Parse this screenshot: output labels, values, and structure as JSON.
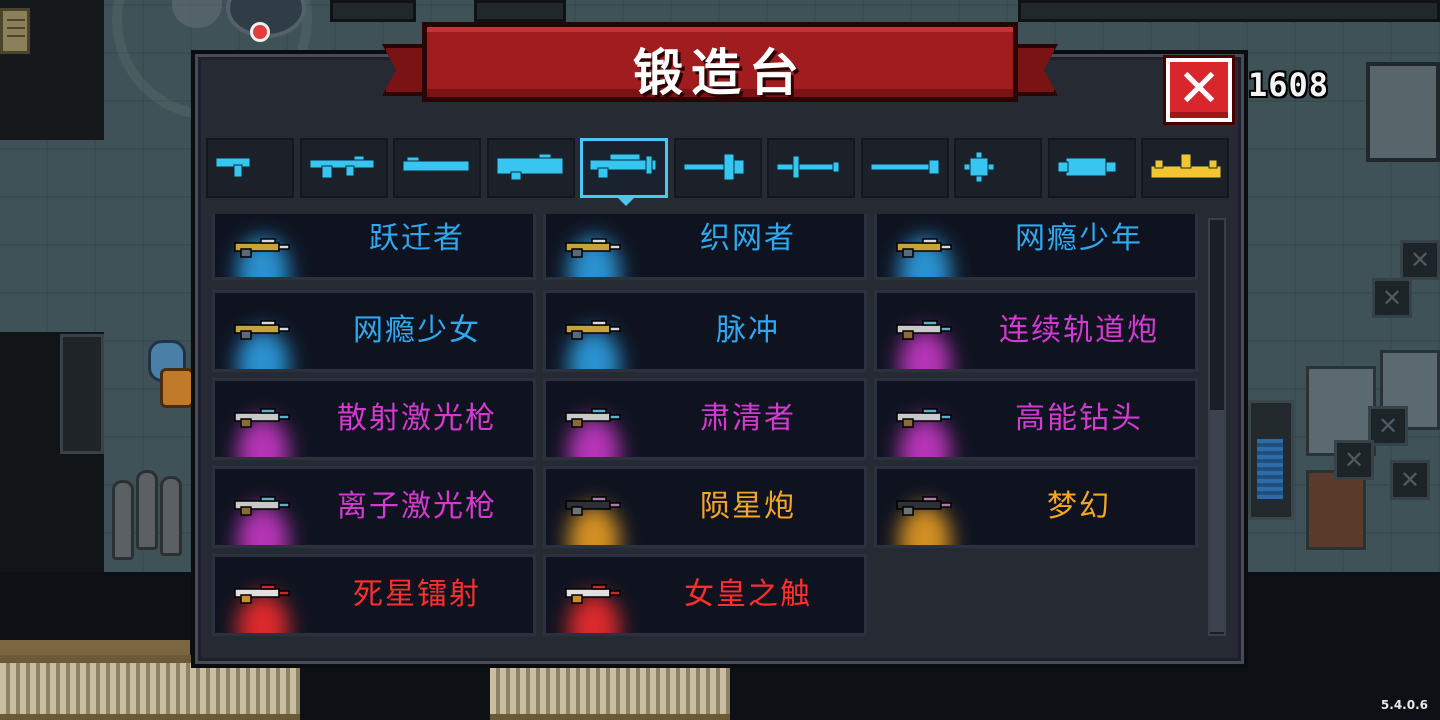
{
  "forge": {
    "title": "锻造台",
    "close_icon": "close-icon",
    "close_glyph": "✕",
    "coins": "1608",
    "version": "5.4.0.6",
    "colors": {
      "blue": "#2fa8f0",
      "purple": "#d23ad0",
      "orange": "#f5a623",
      "red": "#ff2e2e",
      "tab_icon": "#36c6f0",
      "tab_gold": "#f5c531"
    },
    "active_tab_index": 4,
    "tabs": [
      {
        "icon": "pistol-icon"
      },
      {
        "icon": "rifle-icon"
      },
      {
        "icon": "shotgun-icon"
      },
      {
        "icon": "launcher-icon"
      },
      {
        "icon": "laser-rifle-icon"
      },
      {
        "icon": "bow-icon"
      },
      {
        "icon": "sword-icon"
      },
      {
        "icon": "spear-icon"
      },
      {
        "icon": "shuriken-icon"
      },
      {
        "icon": "fish-icon"
      },
      {
        "icon": "crown-icon"
      }
    ],
    "items": [
      {
        "name": "跃迁者",
        "rarity": "blue"
      },
      {
        "name": "织网者",
        "rarity": "blue"
      },
      {
        "name": "网瘾少年",
        "rarity": "blue"
      },
      {
        "name": "网瘾少女",
        "rarity": "blue"
      },
      {
        "name": "脉冲",
        "rarity": "blue"
      },
      {
        "name": "连续轨道炮",
        "rarity": "purple"
      },
      {
        "name": "散射激光枪",
        "rarity": "purple"
      },
      {
        "name": "肃清者",
        "rarity": "purple"
      },
      {
        "name": "高能钻头",
        "rarity": "purple"
      },
      {
        "name": "离子激光枪",
        "rarity": "purple"
      },
      {
        "name": "陨星炮",
        "rarity": "orange"
      },
      {
        "name": "梦幻",
        "rarity": "orange"
      },
      {
        "name": "死星镭射",
        "rarity": "red"
      },
      {
        "name": "女皇之触",
        "rarity": "red"
      }
    ]
  }
}
